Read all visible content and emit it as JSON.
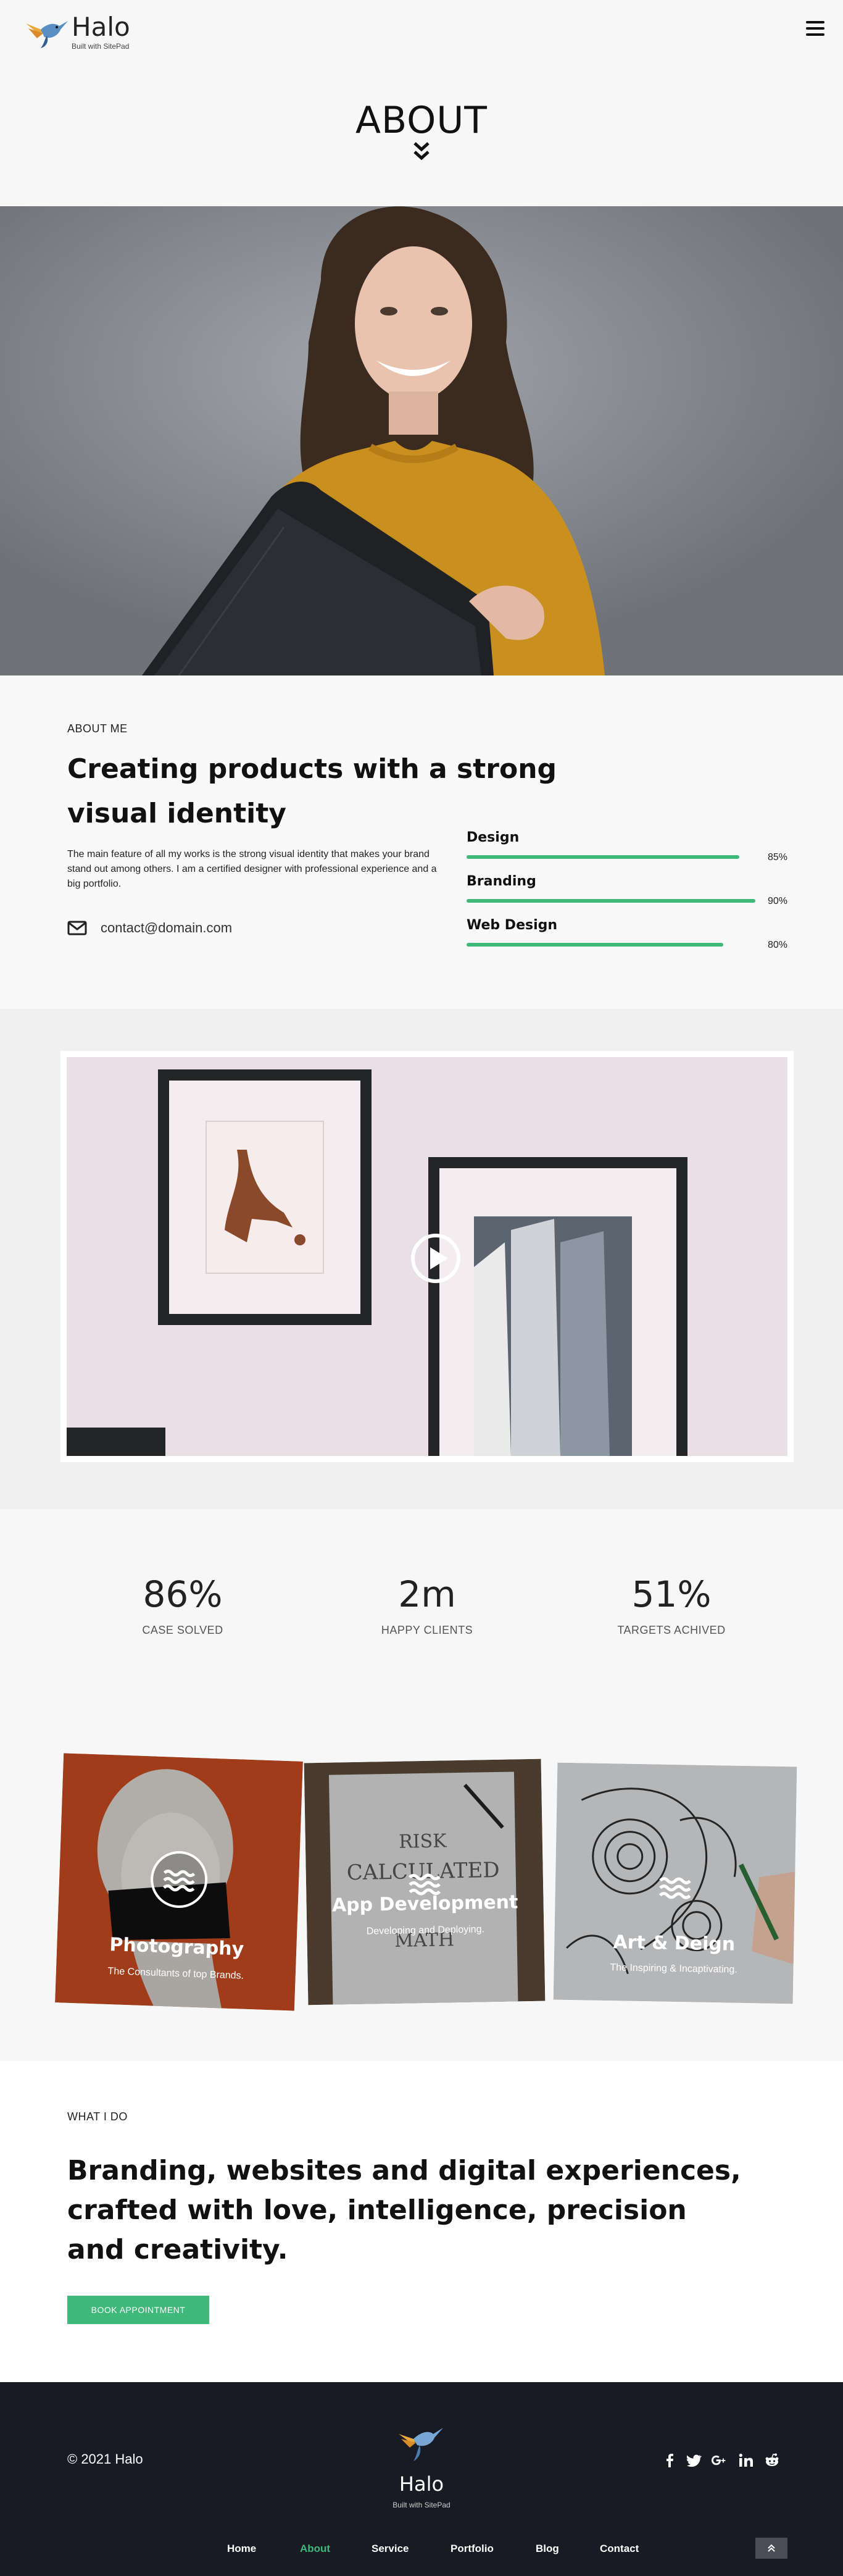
{
  "header": {
    "brand": "Halo",
    "tagline": "Built with SitePad"
  },
  "page": {
    "title": "ABOUT"
  },
  "about": {
    "kicker": "ABOUT ME",
    "heading": "Creating products with a strong visual identity",
    "description": "The main feature of all my works is the strong visual identity that makes your brand stand out among others. I am a certified designer with professional experience and a big portfolio.",
    "email": "contact@domain.com",
    "skills": [
      {
        "label": "Design",
        "percent_text": "85%",
        "value": 0.85
      },
      {
        "label": "Branding",
        "percent_text": "90%",
        "value": 0.9
      },
      {
        "label": "Web Design",
        "percent_text": "80%",
        "value": 0.8
      }
    ]
  },
  "stats": [
    {
      "value": "86%",
      "label": "CASE SOLVED"
    },
    {
      "value": "2m",
      "label": "HAPPY CLIENTS"
    },
    {
      "value": "51%",
      "label": "TARGETS ACHIVED"
    }
  ],
  "cards": [
    {
      "title": "Photography",
      "subtitle": "The Consultants of top Brands."
    },
    {
      "title": "App Development",
      "subtitle": "Developing and Deploying."
    },
    {
      "title": "Art & Deign",
      "subtitle": "The Inspiring & Incaptivating."
    }
  ],
  "whatido": {
    "kicker": "WHAT I DO",
    "heading": "Branding, websites and digital experiences, crafted with love, intelligence, precision and creativity.",
    "button": "BOOK APPOINTMENT"
  },
  "footer": {
    "copyright": "© 2021 Halo",
    "brand": "Halo",
    "tagline": "Built with SitePad",
    "nav": [
      "Home",
      "About",
      "Service",
      "Portfolio",
      "Blog",
      "Contact"
    ],
    "active_nav": "About",
    "social_icons": [
      "facebook-icon",
      "twitter-icon",
      "google-plus-icon",
      "linkedin-icon",
      "reddit-icon"
    ]
  },
  "colors": {
    "accent": "#3fb97a",
    "footer_bg": "#181b24",
    "text": "#222222"
  }
}
